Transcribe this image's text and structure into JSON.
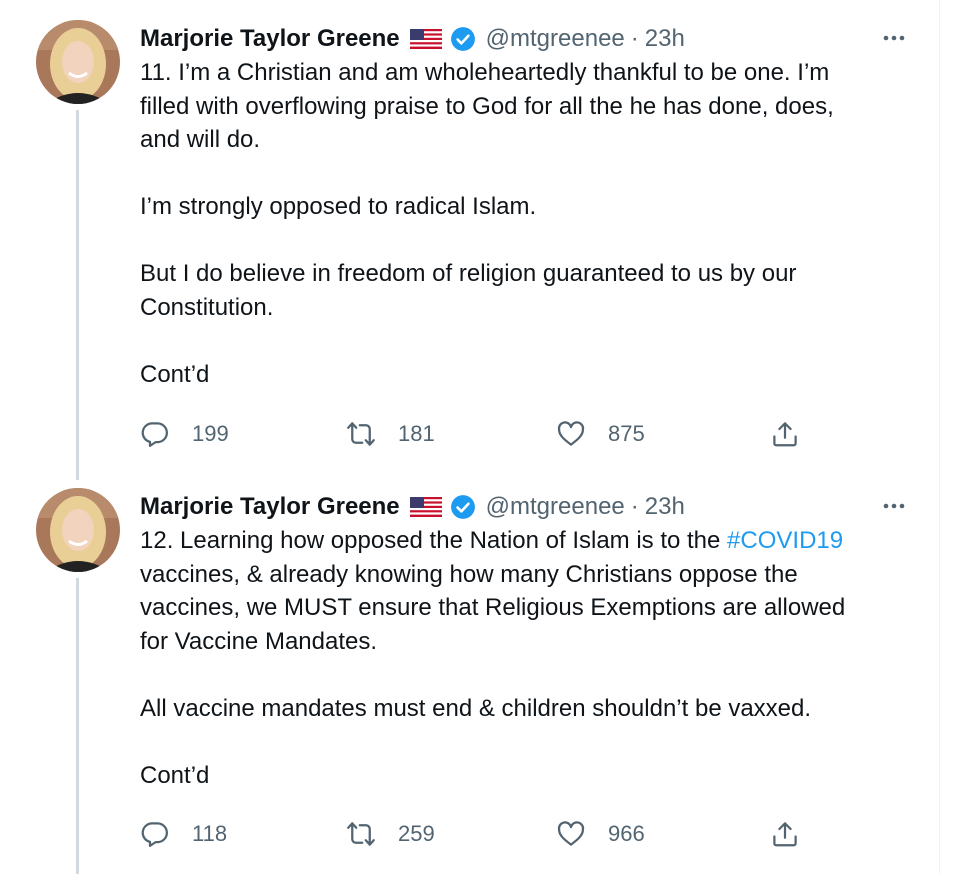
{
  "colors": {
    "text": "#0f1419",
    "secondary": "#536471",
    "link": "#1d9bf0",
    "verified": "#1d9bf0",
    "thread_line": "#cfd9de"
  },
  "tweets": [
    {
      "author_name": "Marjorie Taylor Greene",
      "flag_icon": "us-flag-icon",
      "verified_icon": "verified-badge-icon",
      "handle": "@mtgreenee",
      "separator": "·",
      "time": "23h",
      "more_icon": "more-options-icon",
      "paragraphs": [
        [
          "11. I’m a Christian and am wholeheartedly thankful to be one. I’m",
          "filled with overflowing praise to God for all the he has done, does,",
          "and will do."
        ],
        [
          "I’m strongly opposed to radical Islam."
        ],
        [
          "But I do believe in freedom of religion guaranteed to us by our",
          "Constitution."
        ],
        [
          "Cont’d"
        ]
      ],
      "replies": "199",
      "retweets": "181",
      "likes": "875"
    },
    {
      "author_name": "Marjorie Taylor Greene",
      "flag_icon": "us-flag-icon",
      "verified_icon": "verified-badge-icon",
      "handle": "@mtgreenee",
      "separator": "·",
      "time": "23h",
      "more_icon": "more-options-icon",
      "first_line_text": "12. Learning how opposed the Nation of Islam is to the ",
      "hashtag": "#COVID19",
      "paragraphs": [
        [
          "vaccines, & already knowing how many Christians oppose the",
          "vaccines, we MUST ensure that Religious Exemptions are allowed",
          "for Vaccine Mandates."
        ],
        [
          "All vaccine mandates must end & children shouldn’t be vaxxed."
        ],
        [
          "Cont’d"
        ]
      ],
      "replies": "118",
      "retweets": "259",
      "likes": "966"
    }
  ]
}
